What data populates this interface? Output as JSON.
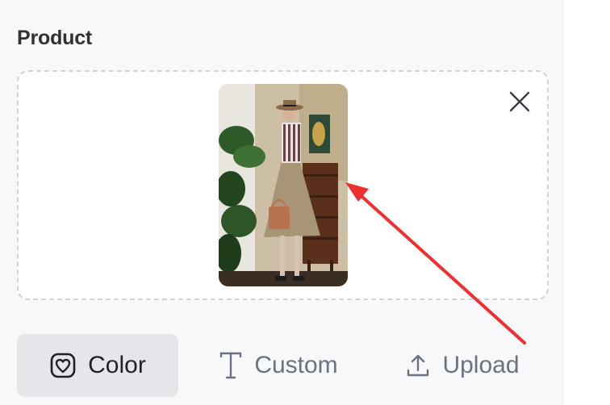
{
  "product": {
    "title": "Product",
    "image": {
      "alt": "",
      "has_image": true
    },
    "remove_icon": "close-icon"
  },
  "modes": [
    {
      "label": "Color",
      "icon": "heart-frame-icon",
      "active": true
    },
    {
      "label": "Custom",
      "icon": "text-cursor-icon",
      "active": false
    },
    {
      "label": "Upload",
      "icon": "upload-icon",
      "active": false
    }
  ],
  "colors": {
    "accent_arrow": "#ee2f2f",
    "dropzone_border": "#cfd3da",
    "active_bg": "#e4e6ea",
    "inactive_text": "#6a7282",
    "active_text": "#1f2125"
  }
}
